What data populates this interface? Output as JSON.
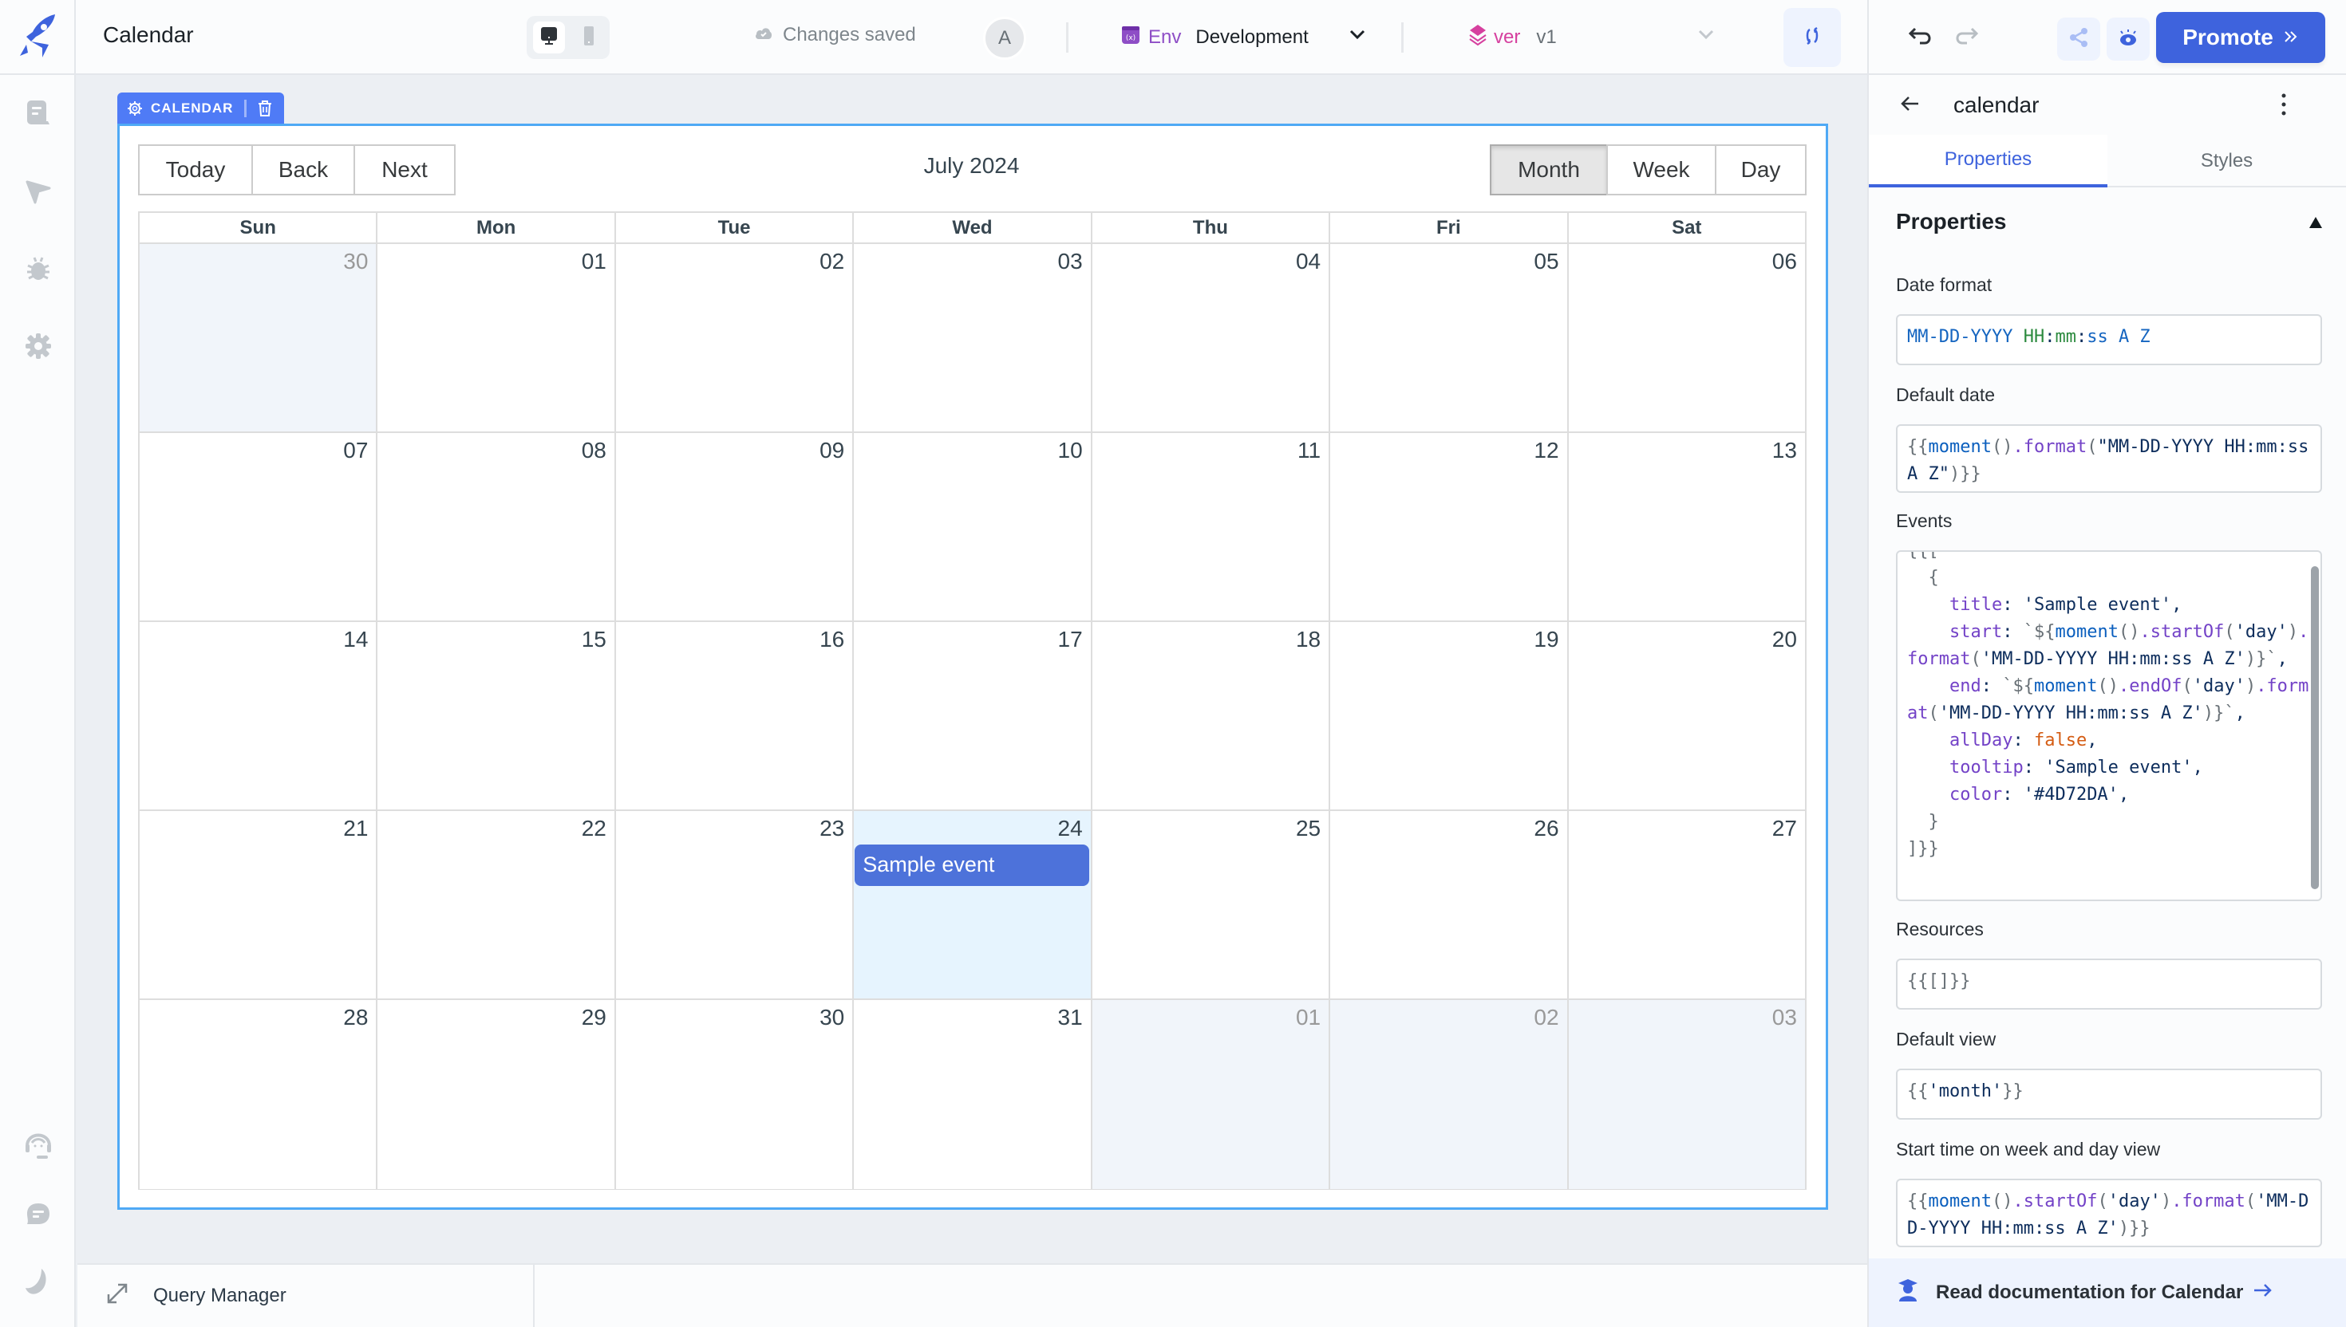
{
  "app": {
    "title": "Calendar",
    "save_status": "Changes saved",
    "avatar_initial": "A",
    "env_label": "Env",
    "env_value": "Development",
    "version_label": "ver",
    "version_value": "v1",
    "promote_label": "Promote",
    "icons": {
      "logo": "rocket-icon",
      "desktop": "desktop-icon",
      "mobile": "mobile-icon",
      "cloud": "cloud-check-icon",
      "env": "variable-icon",
      "version": "layers-icon",
      "sync": "sync-icon",
      "undo": "undo-icon",
      "redo": "redo-icon",
      "share": "share-icon",
      "preview": "eye-icon"
    }
  },
  "sidebar": {
    "top_items": [
      {
        "icon": "pages-icon",
        "label": "Pages"
      },
      {
        "icon": "inspector-icon",
        "label": "Inspector"
      },
      {
        "icon": "debugger-icon",
        "label": "Debugger"
      },
      {
        "icon": "settings-icon",
        "label": "Settings"
      }
    ],
    "bottom_items": [
      {
        "icon": "support-icon",
        "label": "Support"
      },
      {
        "icon": "chat-icon",
        "label": "Comments"
      },
      {
        "icon": "dark-mode-icon",
        "label": "Theme"
      }
    ]
  },
  "widget": {
    "tag_label": "CALENDAR"
  },
  "calendar": {
    "title": "July 2024",
    "nav_buttons": [
      "Today",
      "Back",
      "Next"
    ],
    "view_buttons": [
      "Month",
      "Week",
      "Day"
    ],
    "active_view": "Month",
    "weekdays": [
      "Sun",
      "Mon",
      "Tue",
      "Wed",
      "Thu",
      "Fri",
      "Sat"
    ],
    "weeks": [
      [
        {
          "d": "30",
          "off": true
        },
        {
          "d": "01"
        },
        {
          "d": "02"
        },
        {
          "d": "03"
        },
        {
          "d": "04"
        },
        {
          "d": "05"
        },
        {
          "d": "06"
        }
      ],
      [
        {
          "d": "07"
        },
        {
          "d": "08"
        },
        {
          "d": "09"
        },
        {
          "d": "10"
        },
        {
          "d": "11"
        },
        {
          "d": "12"
        },
        {
          "d": "13"
        }
      ],
      [
        {
          "d": "14"
        },
        {
          "d": "15"
        },
        {
          "d": "16"
        },
        {
          "d": "17"
        },
        {
          "d": "18"
        },
        {
          "d": "19"
        },
        {
          "d": "20"
        }
      ],
      [
        {
          "d": "21"
        },
        {
          "d": "22"
        },
        {
          "d": "23"
        },
        {
          "d": "24",
          "today": true,
          "events": [
            {
              "title": "Sample event",
              "color": "#4D72DA"
            }
          ]
        },
        {
          "d": "25"
        },
        {
          "d": "26"
        },
        {
          "d": "27"
        }
      ],
      [
        {
          "d": "28"
        },
        {
          "d": "29"
        },
        {
          "d": "30"
        },
        {
          "d": "31"
        },
        {
          "d": "01",
          "off": true
        },
        {
          "d": "02",
          "off": true
        },
        {
          "d": "03",
          "off": true
        }
      ]
    ]
  },
  "query_manager": {
    "label": "Query Manager"
  },
  "inspector": {
    "component_name": "calendar",
    "tabs": [
      "Properties",
      "Styles"
    ],
    "active_tab": "Properties",
    "section_title": "Properties",
    "fields": {
      "date_format": {
        "label": "Date format",
        "value": "MM-DD-YYYY HH:mm:ss A Z"
      },
      "default_date": {
        "label": "Default date",
        "value": "{{moment().format(\"MM-DD-YYYY HH:mm:ss A Z\")}}"
      },
      "events": {
        "label": "Events",
        "value": "{{[\n  {\n    title: 'Sample event',\n    start: `${moment().startOf('day').format('MM-DD-YYYY HH:mm:ss A Z')}`,\n    end: `${moment().endOf('day').format('MM-DD-YYYY HH:mm:ss A Z')}`,\n    allDay: false,\n    tooltip: 'Sample event',\n    color: '#4D72DA',\n  }\n]}}"
      },
      "resources": {
        "label": "Resources",
        "value": "{{[]}}"
      },
      "default_view": {
        "label": "Default view",
        "value": "{{'month'}}"
      },
      "start_time": {
        "label": "Start time on week and day view",
        "value": "{{moment().startOf('day').format('MM-DD-YYYY HH:mm:ss A Z')}}"
      }
    },
    "docs_link": "Read documentation for Calendar"
  },
  "colors": {
    "accent": "#3E63DD",
    "event": "#4D72DA",
    "widget_border": "#4FA9F5",
    "today_bg": "#E6F4FE",
    "offrange_bg": "#F1F5FA"
  }
}
